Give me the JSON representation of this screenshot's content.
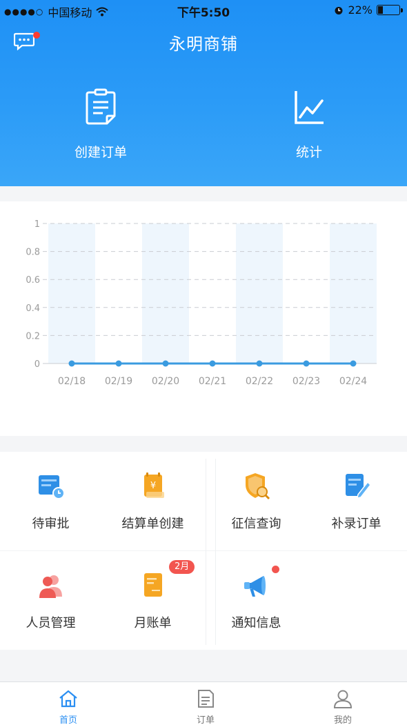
{
  "status_bar": {
    "carrier": "中国移动",
    "time": "下午5:50",
    "battery": "22%",
    "battery_level": 0.22
  },
  "header": {
    "title": "永明商铺",
    "actions": [
      {
        "label": "创建订单",
        "icon": "clipboard-icon"
      },
      {
        "label": "统计",
        "icon": "line-chart-icon"
      }
    ],
    "has_unread_messages": true
  },
  "chart_data": {
    "type": "line",
    "categories": [
      "02/18",
      "02/19",
      "02/20",
      "02/21",
      "02/22",
      "02/23",
      "02/24"
    ],
    "series": [
      {
        "values": [
          0,
          0,
          0,
          0,
          0,
          0,
          0
        ]
      }
    ],
    "y_ticks": [
      "0",
      "0.2",
      "0.4",
      "0.6",
      "0.8",
      "1"
    ],
    "ylim": [
      0,
      1
    ],
    "grid": true,
    "colors": {
      "line": "#3a9be0",
      "band": "#eef6fd"
    }
  },
  "menu": [
    {
      "label": "待审批",
      "icon": "pending-approval-icon"
    },
    {
      "label": "结算单创建",
      "icon": "settlement-create-icon"
    },
    {
      "label": "征信查询",
      "icon": "credit-query-icon"
    },
    {
      "label": "补录订单",
      "icon": "supplement-order-icon"
    },
    {
      "label": "人员管理",
      "icon": "staff-icon"
    },
    {
      "label": "月账单",
      "icon": "monthly-bill-icon",
      "badge": "2月"
    },
    {
      "label": "通知信息",
      "icon": "megaphone-icon",
      "dot": true
    }
  ],
  "tabbar": [
    {
      "label": "首页",
      "icon": "home-icon",
      "active": true
    },
    {
      "label": "订单",
      "icon": "document-icon",
      "active": false
    },
    {
      "label": "我的",
      "icon": "user-icon",
      "active": false
    }
  ],
  "colors": {
    "primary": "#2b8ff2",
    "accent_red": "#f2554f",
    "orange": "#f5a623"
  }
}
